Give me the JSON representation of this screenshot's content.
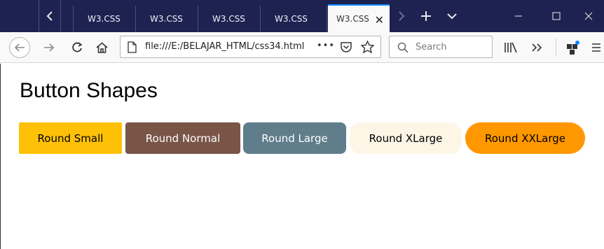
{
  "browser": {
    "tabs": [
      {
        "label": "W3.CSS"
      },
      {
        "label": "W3.CSS"
      },
      {
        "label": "W3.CSS"
      },
      {
        "label": "W3.CSS"
      },
      {
        "label": "W3.CSS"
      }
    ],
    "url": "file:///E:/BELAJAR_HTML/css34.html",
    "search_placeholder": "Search",
    "page_actions": "•••"
  },
  "page": {
    "title": "Button Shapes",
    "buttons": [
      {
        "label": "Round Small",
        "bg": "#ffc107",
        "color": "#000000"
      },
      {
        "label": "Round Normal",
        "bg": "#795548",
        "color": "#ffffff"
      },
      {
        "label": "Round Large",
        "bg": "#607d8b",
        "color": "#ffffff"
      },
      {
        "label": "Round XLarge",
        "bg": "#fdf5e6",
        "color": "#000000"
      },
      {
        "label": "Round XXLarge",
        "bg": "#ff9800",
        "color": "#000000"
      }
    ]
  },
  "colors": {
    "tabbar": "#1e2250",
    "accent": "#0a84ff"
  },
  "icons": [
    "chevron-left-icon",
    "plus-icon",
    "chevron-down-icon",
    "minimize-icon",
    "maximize-icon",
    "close-icon",
    "back-icon",
    "forward-icon",
    "reload-icon",
    "home-icon",
    "page-icon",
    "pocket-icon",
    "bookmark-star-icon",
    "search-icon",
    "library-icon",
    "overflow-icon",
    "extension-icon",
    "menu-icon"
  ]
}
